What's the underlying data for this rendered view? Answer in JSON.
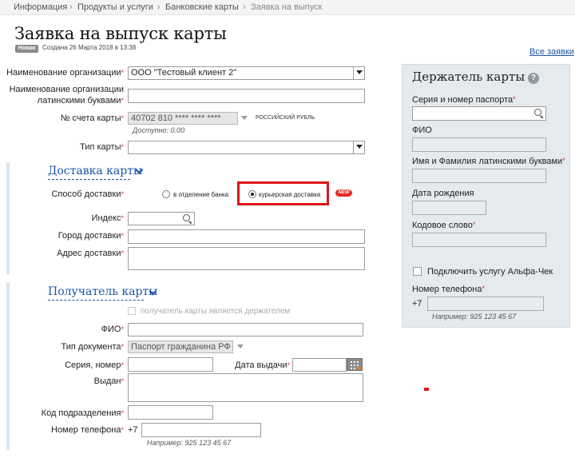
{
  "breadcrumb": {
    "items": [
      "Информация",
      "Продукты и услуги",
      "Банковские карты",
      "Заявка на выпуск"
    ],
    "separator": "›"
  },
  "page": {
    "title": "Заявка на выпуск карты",
    "status_badge": "Новая",
    "created": "Создана 26 Марта 2018 в 13:38",
    "all_orders_link": "Все заявки"
  },
  "org": {
    "name_label": "Наименование организации",
    "name_value": "ООО \"Тестовый клиент 2\"",
    "latin_label_1": "Наименование организации",
    "latin_label_2": "латинскими буквами",
    "latin_value": "",
    "account_label": "№ счета карты",
    "account_value": "40702 810 **** **** ****",
    "currency": "РОССИЙСКИЙ РУБЛЬ",
    "available": "Доступно: 0.00",
    "card_type_label": "Тип карты",
    "card_type_value": ""
  },
  "delivery": {
    "section_title": "Доставка карты",
    "method_label": "Способ доставки",
    "option_branch": "в отделение банка",
    "option_courier": "курьерская доставка",
    "new_badge": "NEW",
    "selected": "курьерская доставка",
    "index_label": "Индекс",
    "index_value": "",
    "city_label": "Город доставки",
    "city_value": "",
    "address_label": "Адрес доставки",
    "address_value": ""
  },
  "recipient": {
    "section_title": "Получатель карты",
    "same_as_holder": "получатель карты является держателем",
    "fio_label": "ФИО",
    "fio_value": "",
    "doc_type_label": "Тип документа",
    "doc_type_value": "Паспорт гражданина РФ",
    "series_label": "Серия, номер",
    "series_value": "",
    "issue_date_label": "Дата выдачи",
    "issue_date_value": "",
    "issued_by_label": "Выдан",
    "issued_by_value": "",
    "dept_code_label": "Код подразделения",
    "dept_code_value": "",
    "phone_label": "Номер телефона",
    "phone_prefix": "+7",
    "phone_value": "",
    "phone_hint": "Например: 925 123 45 67"
  },
  "holder": {
    "title": "Держатель карты",
    "help_icon": "?",
    "passport_label": "Серия и номер паспорта",
    "passport_value": "",
    "fio_label": "ФИО",
    "fio_value": "",
    "latin_name_label": "Имя и Фамилия латинскими буквами",
    "latin_name_value": "",
    "birth_label": "Дата рождения",
    "birth_value": "",
    "code_word_label": "Кодовое слово",
    "code_word_value": "",
    "alfa_check_label": "Подключить услугу Альфа-Чек",
    "phone_label": "Номер телефона",
    "phone_prefix": "+7",
    "phone_value": "",
    "phone_hint": "Например: 925 123 45 67"
  },
  "required_mark": "*",
  "colors": {
    "link": "#1a54a8",
    "required": "#d0312d",
    "highlight_frame": "#e0141b",
    "panel_bg": "#e4eaed"
  }
}
